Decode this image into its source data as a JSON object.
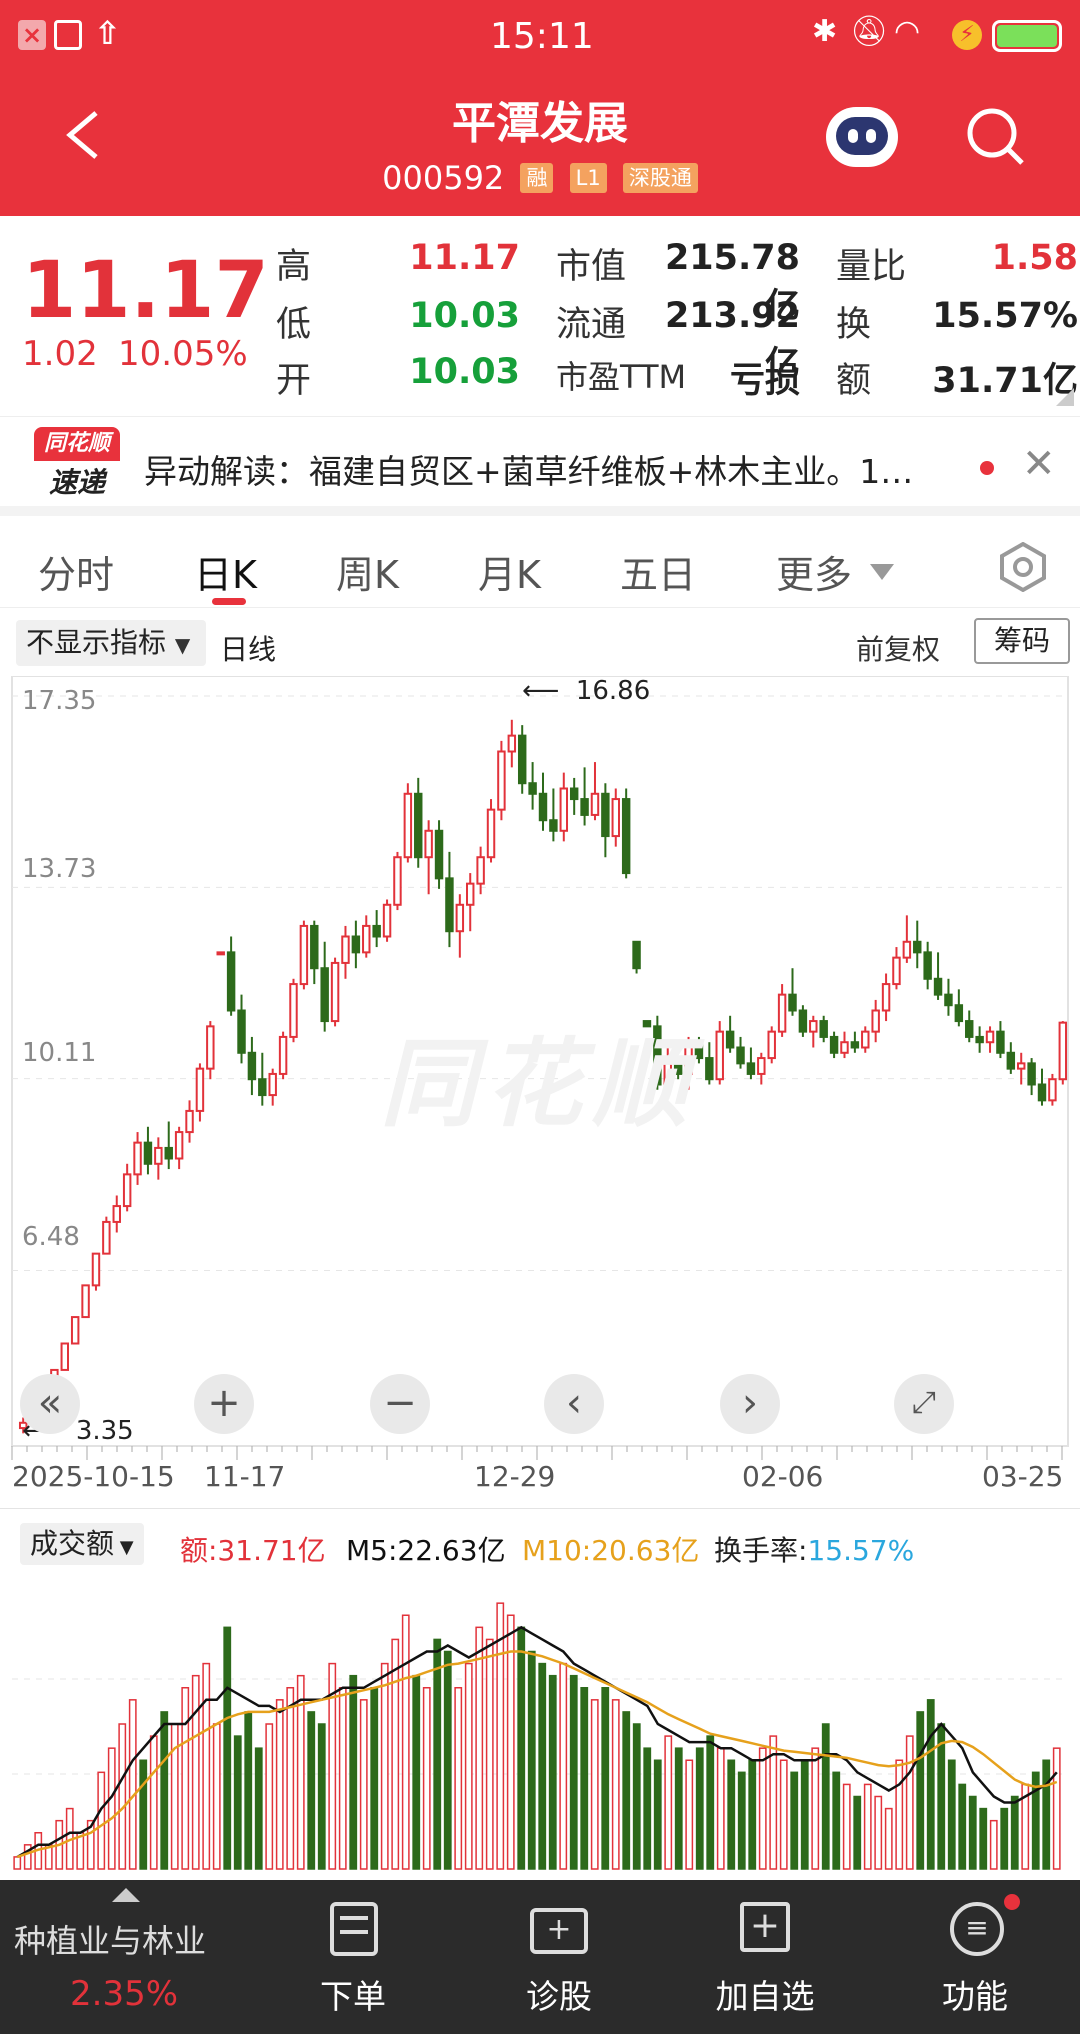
{
  "status": {
    "time": "15:11"
  },
  "header": {
    "name": "平潭发展",
    "code": "000592",
    "badges": [
      "融",
      "L1",
      "深股通"
    ]
  },
  "quote": {
    "price": "11.17",
    "change": "1.02",
    "pct": "10.05%",
    "rows": [
      {
        "l1": "高",
        "v1": "11.17",
        "l2": "市值",
        "v2": "215.78亿",
        "l3": "量比",
        "v3": "1.58"
      },
      {
        "l1": "低",
        "v1": "10.03",
        "l2": "流通",
        "v2": "213.92亿",
        "l3": "换",
        "v3": "15.57%"
      },
      {
        "l1": "开",
        "v1": "10.03",
        "l2": "市盈TTM",
        "v2": "亏损",
        "l3": "额",
        "v3": "31.71亿"
      }
    ]
  },
  "news": {
    "logo_top": "同花顺",
    "logo_bottom": "速递",
    "text": "异动解读：福建自贸区+菌草纤维板+林木主业。1…"
  },
  "tabs": [
    "分时",
    "日K",
    "周K",
    "月K",
    "五日",
    "更多"
  ],
  "active_tab": 1,
  "chart_controls": {
    "indicator": "不显示指标",
    "period": "日线",
    "adjust": "前复权",
    "chips": "筹码"
  },
  "kline": {
    "y_ticks": [
      "17.35",
      "13.73",
      "10.11",
      "6.48"
    ],
    "x_ticks": [
      "2025-10-15",
      "11-17",
      "12-29",
      "02-06",
      "03-25"
    ],
    "max_label": "16.86",
    "min_label": "3.35",
    "watermark": "同花顺"
  },
  "volume_legend": {
    "selector": "成交额",
    "amount": "额:31.71亿",
    "m5": "M5:22.63亿",
    "m10": "M10:20.63亿",
    "turnover_label": "换手率:",
    "turnover": "15.57%"
  },
  "bottom": {
    "sector": "种植业与林业",
    "sector_pct": "2.35%",
    "items": [
      "下单",
      "诊股",
      "加自选",
      "功能"
    ]
  },
  "colors": {
    "up": "#e2323a",
    "down": "#2d6a1b",
    "header": "#e8323c",
    "m10": "#e6a11c",
    "turnover": "#2aa7de"
  },
  "chart_data": [
    {
      "type": "candlestick",
      "title": "日K",
      "x_start": "2025-10-15",
      "x_end": "03-25",
      "ylim": [
        3.35,
        17.35
      ],
      "y_ticks": [
        17.35,
        13.73,
        10.11,
        6.48
      ],
      "labeled_high": 16.86,
      "labeled_low": 3.35,
      "ohlc": [
        [
          3.5,
          3.7,
          3.4,
          3.6
        ],
        [
          3.6,
          3.9,
          3.5,
          3.8
        ],
        [
          3.8,
          4.2,
          3.8,
          4.2
        ],
        [
          4.2,
          4.6,
          4.2,
          4.6
        ],
        [
          4.6,
          5.1,
          4.6,
          5.1
        ],
        [
          5.1,
          5.6,
          5.1,
          5.6
        ],
        [
          5.6,
          6.2,
          5.6,
          6.2
        ],
        [
          6.2,
          6.8,
          6.1,
          6.8
        ],
        [
          6.8,
          7.5,
          6.8,
          7.4
        ],
        [
          7.4,
          7.9,
          7.2,
          7.7
        ],
        [
          7.7,
          8.5,
          7.6,
          8.3
        ],
        [
          8.3,
          9.1,
          8.1,
          8.9
        ],
        [
          8.9,
          9.2,
          8.3,
          8.5
        ],
        [
          8.5,
          9.0,
          8.2,
          8.8
        ],
        [
          8.8,
          9.3,
          8.4,
          8.6
        ],
        [
          8.6,
          9.2,
          8.4,
          9.1
        ],
        [
          9.1,
          9.7,
          8.9,
          9.5
        ],
        [
          9.5,
          10.4,
          9.3,
          10.3
        ],
        [
          10.3,
          11.2,
          10.1,
          11.1
        ],
        [
          12.5,
          12.5,
          12.5,
          12.5
        ],
        [
          12.5,
          12.8,
          11.3,
          11.4
        ],
        [
          11.4,
          11.7,
          10.4,
          10.6
        ],
        [
          10.6,
          10.9,
          9.8,
          10.1
        ],
        [
          10.1,
          10.6,
          9.6,
          9.8
        ],
        [
          9.8,
          10.3,
          9.6,
          10.2
        ],
        [
          10.2,
          11.0,
          10.1,
          10.9
        ],
        [
          10.9,
          12.0,
          10.8,
          11.9
        ],
        [
          11.9,
          13.1,
          11.8,
          13.0
        ],
        [
          13.0,
          13.1,
          11.9,
          12.2
        ],
        [
          12.2,
          12.7,
          11.0,
          11.2
        ],
        [
          11.2,
          12.4,
          11.1,
          12.3
        ],
        [
          12.3,
          13.0,
          12.0,
          12.8
        ],
        [
          12.8,
          13.1,
          12.2,
          12.5
        ],
        [
          12.5,
          13.2,
          12.4,
          13.0
        ],
        [
          13.0,
          13.3,
          12.6,
          12.8
        ],
        [
          12.8,
          13.5,
          12.7,
          13.4
        ],
        [
          13.4,
          14.4,
          13.3,
          14.3
        ],
        [
          14.3,
          15.7,
          14.2,
          15.5
        ],
        [
          15.5,
          15.8,
          14.1,
          14.3
        ],
        [
          14.3,
          15.0,
          13.6,
          14.8
        ],
        [
          14.8,
          15.0,
          13.7,
          13.9
        ],
        [
          13.9,
          14.4,
          12.6,
          12.9
        ],
        [
          12.9,
          13.6,
          12.4,
          13.4
        ],
        [
          13.4,
          14.0,
          12.9,
          13.8
        ],
        [
          13.8,
          14.5,
          13.6,
          14.3
        ],
        [
          14.3,
          15.4,
          14.2,
          15.2
        ],
        [
          15.2,
          16.5,
          15.0,
          16.3
        ],
        [
          16.3,
          16.9,
          16.0,
          16.6
        ],
        [
          16.6,
          16.8,
          15.5,
          15.7
        ],
        [
          15.7,
          16.1,
          15.2,
          15.5
        ],
        [
          15.5,
          15.9,
          14.8,
          15.0
        ],
        [
          15.0,
          15.6,
          14.6,
          14.8
        ],
        [
          14.8,
          15.9,
          14.6,
          15.6
        ],
        [
          15.6,
          15.8,
          15.1,
          15.4
        ],
        [
          15.4,
          16.0,
          14.9,
          15.1
        ],
        [
          15.1,
          16.1,
          15.0,
          15.5
        ],
        [
          15.5,
          15.7,
          14.3,
          14.7
        ],
        [
          14.7,
          15.6,
          14.5,
          15.4
        ],
        [
          15.4,
          15.6,
          13.9,
          14.0
        ],
        [
          12.7,
          12.7,
          12.1,
          12.2
        ],
        [
          11.2,
          11.2,
          11.1,
          11.1
        ],
        [
          11.1,
          11.3,
          9.9,
          10.0
        ],
        [
          10.0,
          10.7,
          9.8,
          10.5
        ],
        [
          10.5,
          10.5,
          10.1,
          10.2
        ],
        [
          10.2,
          10.9,
          9.9,
          10.8
        ],
        [
          10.8,
          10.9,
          10.4,
          10.5
        ],
        [
          10.5,
          10.8,
          10.0,
          10.1
        ],
        [
          10.1,
          11.2,
          10.0,
          11.0
        ],
        [
          11.0,
          11.3,
          10.6,
          10.7
        ],
        [
          10.7,
          10.9,
          10.3,
          10.4
        ],
        [
          10.4,
          10.7,
          10.1,
          10.2
        ],
        [
          10.2,
          10.6,
          10.0,
          10.5
        ],
        [
          10.5,
          11.1,
          10.4,
          11.0
        ],
        [
          11.0,
          11.9,
          10.9,
          11.7
        ],
        [
          11.7,
          12.2,
          11.3,
          11.4
        ],
        [
          11.4,
          11.5,
          10.9,
          11.0
        ],
        [
          11.0,
          11.3,
          10.7,
          11.2
        ],
        [
          11.2,
          11.3,
          10.8,
          10.9
        ],
        [
          10.9,
          11.0,
          10.5,
          10.6
        ],
        [
          10.6,
          11.0,
          10.5,
          10.8
        ],
        [
          10.8,
          11.0,
          10.6,
          10.7
        ],
        [
          10.7,
          11.1,
          10.6,
          11.0
        ],
        [
          11.0,
          11.6,
          10.8,
          11.4
        ],
        [
          11.4,
          12.1,
          11.2,
          11.9
        ],
        [
          11.9,
          12.6,
          11.8,
          12.4
        ],
        [
          12.4,
          13.2,
          12.3,
          12.7
        ],
        [
          12.7,
          13.1,
          12.2,
          12.5
        ],
        [
          12.5,
          12.7,
          11.8,
          12.0
        ],
        [
          12.0,
          12.5,
          11.6,
          11.7
        ],
        [
          11.7,
          12.0,
          11.3,
          11.5
        ],
        [
          11.5,
          11.8,
          11.1,
          11.2
        ],
        [
          11.2,
          11.4,
          10.8,
          10.9
        ],
        [
          10.9,
          11.1,
          10.6,
          10.8
        ],
        [
          10.8,
          11.1,
          10.6,
          11.0
        ],
        [
          11.0,
          11.2,
          10.5,
          10.6
        ],
        [
          10.6,
          10.8,
          10.2,
          10.3
        ],
        [
          10.3,
          10.6,
          10.0,
          10.4
        ],
        [
          10.4,
          10.5,
          9.8,
          10.0
        ],
        [
          10.0,
          10.3,
          9.6,
          9.7
        ],
        [
          9.7,
          10.2,
          9.6,
          10.1
        ],
        [
          10.1,
          11.2,
          10.0,
          11.17
        ]
      ]
    },
    {
      "type": "bar",
      "title": "成交额",
      "series": [
        {
          "name": "额",
          "values": [
            1,
            2,
            3,
            2,
            4,
            5,
            3,
            4,
            8,
            10,
            12,
            14,
            9,
            11,
            13,
            12,
            15,
            16,
            17,
            12,
            20,
            11,
            13,
            10,
            12,
            14,
            15,
            16,
            13,
            12,
            17,
            15,
            16,
            14,
            15,
            17,
            19,
            21,
            16,
            15,
            19,
            18,
            15,
            17,
            20,
            19,
            22,
            21,
            20,
            18,
            17,
            16,
            17,
            16,
            15,
            14,
            15,
            14,
            13,
            12,
            10,
            9,
            11,
            10,
            9,
            10,
            11,
            10,
            9,
            8,
            9,
            10,
            11,
            9,
            8,
            9,
            10,
            12,
            8,
            7,
            6,
            7,
            6,
            5,
            9,
            11,
            13,
            14,
            12,
            9,
            7,
            6,
            5,
            4,
            5,
            6,
            7,
            8,
            9,
            10
          ]
        },
        {
          "name": "M5",
          "values": [
            1,
            1.5,
            2,
            2,
            2.5,
            3,
            3,
            3.5,
            5,
            6,
            7.5,
            9,
            10,
            11,
            12,
            12,
            12,
            13,
            14,
            14,
            15,
            14.5,
            14,
            13.5,
            13.5,
            13,
            13.5,
            14,
            14,
            14,
            14.5,
            15,
            15,
            15,
            15.5,
            16,
            16.5,
            17,
            17.5,
            18,
            18,
            18.5,
            18,
            17.5,
            18,
            18.5,
            19,
            19.5,
            20,
            19.5,
            19,
            18.5,
            18,
            17,
            16.5,
            16,
            15.5,
            15,
            14.5,
            14,
            13.5,
            12,
            11.5,
            11,
            10.5,
            10.5,
            10.5,
            10,
            10,
            9.5,
            9,
            9,
            9.5,
            9.5,
            9,
            9,
            9,
            9.5,
            9.5,
            9,
            8,
            7.5,
            7,
            6.5,
            7,
            8,
            9.5,
            11,
            12,
            11,
            10,
            8,
            7,
            6,
            5.5,
            5.5,
            6,
            6.5,
            7,
            8
          ]
        },
        {
          "name": "M10",
          "values": [
            1,
            1.3,
            1.6,
            1.8,
            2,
            2.4,
            2.7,
            3,
            3.6,
            4.2,
            5,
            6,
            7,
            8,
            9,
            10,
            10.5,
            11,
            11.5,
            12,
            12.5,
            12.8,
            13,
            13,
            13,
            13.2,
            13.4,
            13.6,
            13.8,
            14,
            14.2,
            14.4,
            14.6,
            14.8,
            15,
            15.2,
            15.5,
            15.8,
            16,
            16.3,
            16.6,
            16.9,
            17,
            17.2,
            17.4,
            17.6,
            17.8,
            18,
            18,
            17.8,
            17.6,
            17.3,
            17,
            16.6,
            16.2,
            15.8,
            15.4,
            15,
            14.6,
            14.2,
            13.8,
            13.3,
            12.8,
            12.4,
            12,
            11.6,
            11.2,
            11,
            10.8,
            10.6,
            10.4,
            10.2,
            10,
            9.8,
            9.7,
            9.6,
            9.5,
            9.4,
            9.3,
            9.2,
            9,
            8.8,
            8.6,
            8.5,
            8.6,
            8.8,
            9.2,
            9.8,
            10.4,
            10.6,
            10.5,
            10.1,
            9.5,
            8.8,
            8.1,
            7.4,
            7,
            6.8,
            6.9,
            7.2
          ]
        }
      ]
    }
  ]
}
